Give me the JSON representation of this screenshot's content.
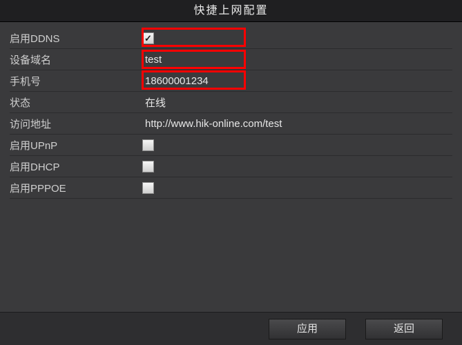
{
  "title": "快捷上网配置",
  "fields": {
    "enable_ddns": {
      "label": "启用DDNS",
      "checked": true
    },
    "device_domain": {
      "label": "设备域名",
      "value": "test"
    },
    "phone": {
      "label": "手机号",
      "value": "18600001234"
    },
    "status": {
      "label": "状态",
      "value": "在线"
    },
    "access_url": {
      "label": "访问地址",
      "value": "http://www.hik-online.com/test"
    },
    "enable_upnp": {
      "label": "启用UPnP",
      "checked": false
    },
    "enable_dhcp": {
      "label": "启用DHCP",
      "checked": false
    },
    "enable_pppoe": {
      "label": "启用PPPOE",
      "checked": false
    }
  },
  "buttons": {
    "apply": "应用",
    "back": "返回"
  }
}
